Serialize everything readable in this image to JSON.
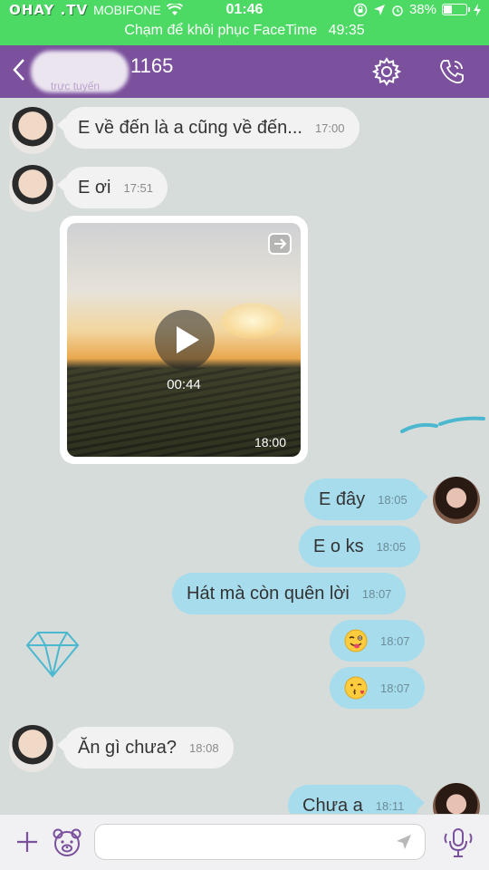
{
  "status_bar": {
    "watermark": "OHAY .TV",
    "carrier": "MOBIFONE",
    "time": "01:46",
    "battery": "38%",
    "battery_level": 0.38,
    "facetime_text": "Chạm để khôi phục FaceTime",
    "facetime_timer": "49:35"
  },
  "header": {
    "contact_name": "1165",
    "subtitle": "trực tuyến"
  },
  "messages": [
    {
      "text": "E về đến là a cũng về đến...",
      "time": "17:00",
      "direction": "incoming"
    },
    {
      "text": "E ơi",
      "time": "17:51",
      "direction": "incoming"
    },
    {
      "type": "video",
      "duration": "00:44",
      "time": "18:00",
      "direction": "incoming"
    },
    {
      "text": "E đây",
      "time": "18:05",
      "direction": "outgoing"
    },
    {
      "text": "E o ks",
      "time": "18:05",
      "direction": "outgoing"
    },
    {
      "text": "Hát mà còn quên lời",
      "time": "18:07",
      "direction": "outgoing"
    },
    {
      "emoji": "winking-face-tongue",
      "time": "18:07",
      "direction": "outgoing"
    },
    {
      "emoji": "face-blowing-kiss",
      "time": "18:07",
      "direction": "outgoing"
    },
    {
      "text": "Ăn gì chưa?",
      "time": "18:08",
      "direction": "incoming"
    },
    {
      "text": "Chưa a",
      "time": "18:11",
      "direction": "outgoing"
    }
  ],
  "input_bar": {
    "placeholder": ""
  },
  "colors": {
    "status_green": "#4cd964",
    "header_purple": "#7b519d",
    "incoming_bubble": "#f2f2f2",
    "outgoing_bubble": "#a7dced",
    "accent_icon": "#7b519d"
  }
}
